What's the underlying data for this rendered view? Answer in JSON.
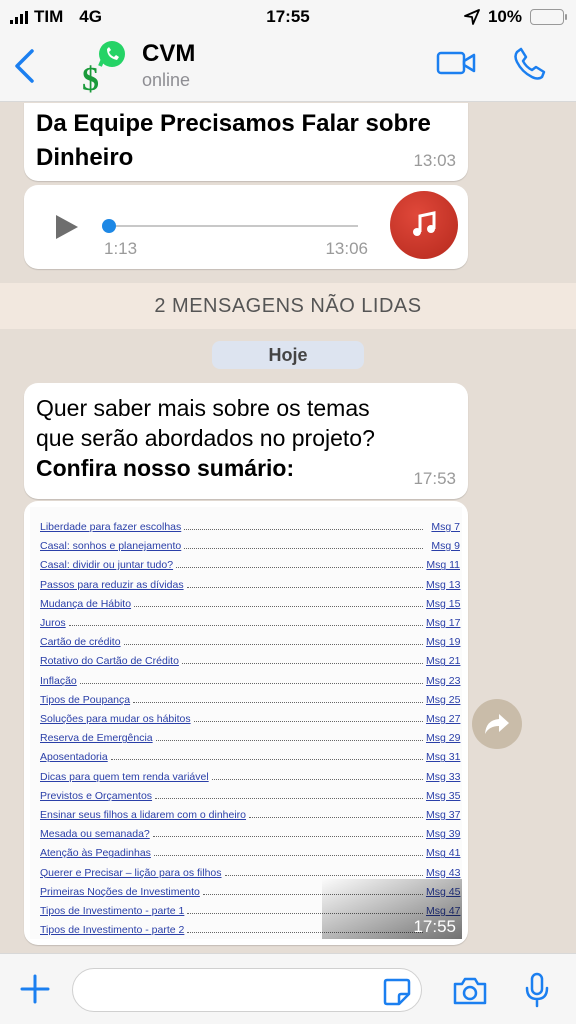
{
  "status_bar": {
    "carrier": "TIM",
    "network": "4G",
    "time": "17:55",
    "battery": "10%",
    "battery_level": 0.1
  },
  "header": {
    "contact_name": "CVM",
    "contact_status": "online"
  },
  "messages": {
    "m1_text": "Da Equipe Precisamos Falar sobre Dinheiro",
    "m1_time": "13:03",
    "audio_duration": "1:13",
    "audio_time": "13:06",
    "unread_banner": "2 MENSAGENS NÃO LIDAS",
    "date_chip": "Hoje",
    "m3_line1": "Quer saber mais sobre os temas",
    "m3_line2": "que serão abordados no projeto?",
    "m3_line3": "Confira nosso sumário:",
    "m3_time": "17:53",
    "image_time": "17:55"
  },
  "toc": [
    {
      "title": "Liberdade para fazer escolhas",
      "page": "Msg 7"
    },
    {
      "title": "Casal: sonhos e planejamento",
      "page": "Msg 9"
    },
    {
      "title": "Casal: dividir ou juntar tudo?",
      "page": "Msg 11"
    },
    {
      "title": "Passos para reduzir as dívidas",
      "page": "Msg 13"
    },
    {
      "title": "Mudança de Hábito",
      "page": "Msg 15"
    },
    {
      "title": "Juros",
      "page": "Msg 17"
    },
    {
      "title": "Cartão de crédito",
      "page": "Msg 19"
    },
    {
      "title": "Rotativo do Cartão de Crédito",
      "page": "Msg 21"
    },
    {
      "title": "Inflação",
      "page": "Msg 23"
    },
    {
      "title": "Tipos de Poupança",
      "page": "Msg 25"
    },
    {
      "title": "Soluções para mudar os hábitos",
      "page": "Msg 27"
    },
    {
      "title": "Reserva de Emergência",
      "page": "Msg 29"
    },
    {
      "title": "Aposentadoria",
      "page": "Msg 31"
    },
    {
      "title": "Dicas para quem tem renda variável",
      "page": "Msg 33"
    },
    {
      "title": "Previstos e Orçamentos",
      "page": "Msg 35"
    },
    {
      "title": "Ensinar seus filhos a lidarem com o dinheiro",
      "page": "Msg 37"
    },
    {
      "title": "Mesada ou semanada?",
      "page": "Msg 39"
    },
    {
      "title": "Atenção às Pegadinhas",
      "page": "Msg 41"
    },
    {
      "title": "Querer e Precisar – lição para os filhos",
      "page": "Msg 43"
    },
    {
      "title": "Primeiras Noções de Investimento",
      "page": "Msg 45"
    },
    {
      "title": "Tipos de Investimento - parte 1",
      "page": "Msg 47"
    },
    {
      "title": "Tipos de Investimento - parte 2",
      "page": ""
    }
  ],
  "colors": {
    "accent": "#1e88e5",
    "chat_bg": "#e5ddd5",
    "whatsapp_green": "#25d366"
  },
  "icons": [
    "back-icon",
    "whatsapp-icon",
    "video-call-icon",
    "phone-icon",
    "play-icon",
    "music-icon",
    "forward-icon",
    "plus-icon",
    "sticker-icon",
    "camera-icon",
    "mic-icon"
  ]
}
